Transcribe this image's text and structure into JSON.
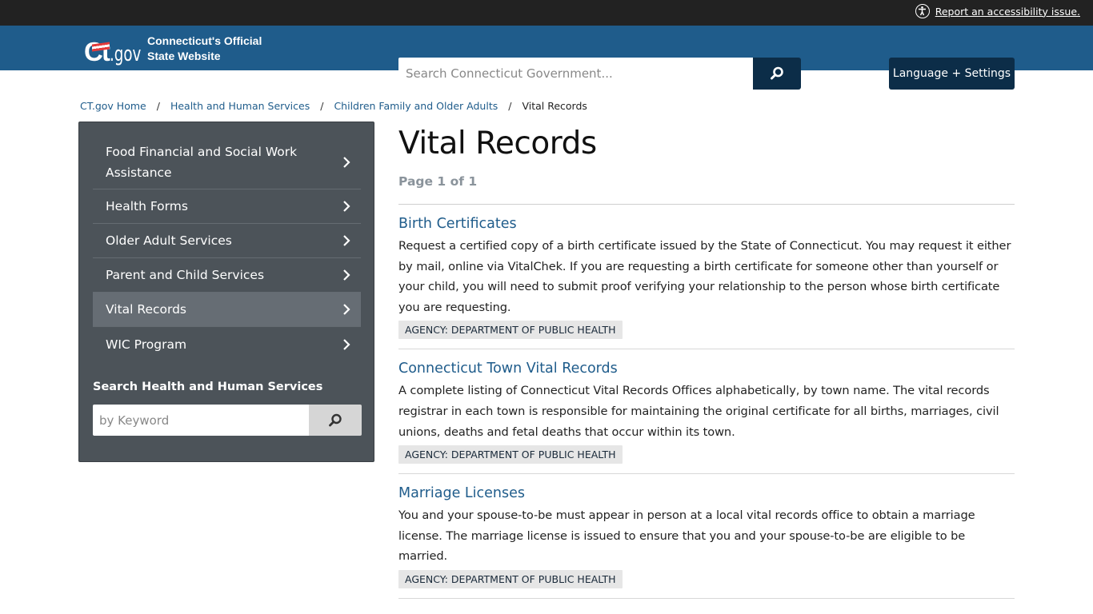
{
  "topbar": {
    "accessibility_link": "Report an accessibility issue."
  },
  "header": {
    "logo_ct": "Ct",
    "logo_gov": ".gov",
    "site_title_line1": "Connecticut's Official",
    "site_title_line2": "State Website",
    "search_placeholder": "Search Connecticut Government...",
    "language_button": "Language + Settings"
  },
  "breadcrumb": [
    {
      "label": "CT.gov Home"
    },
    {
      "label": "Health and Human Services"
    },
    {
      "label": "Children Family and Older Adults"
    },
    {
      "label": "Vital Records"
    }
  ],
  "sidebar": {
    "items": [
      {
        "label": "Food Financial and Social Work Assistance"
      },
      {
        "label": "Health Forms"
      },
      {
        "label": "Older Adult Services"
      },
      {
        "label": "Parent and Child Services"
      },
      {
        "label": "Vital Records",
        "active": true
      },
      {
        "label": "WIC Program"
      }
    ],
    "search_label": "Search Health and Human Services",
    "search_placeholder": "by Keyword"
  },
  "main": {
    "title": "Vital Records",
    "pager": "Page 1 of 1",
    "results": [
      {
        "title": "Birth Certificates",
        "description": "Request a certified copy of a birth certificate issued by the State of Connecticut. You may request it either by mail, online via VitalChek. If you are requesting a birth certificate for someone other than yourself or your child, you will need to submit proof verifying your relationship to the person whose birth certificate you are requesting.",
        "agency": "AGENCY: DEPARTMENT OF PUBLIC HEALTH"
      },
      {
        "title": "Connecticut Town Vital Records",
        "description": "A complete listing of Connecticut Vital Records Offices alphabetically, by town name. The vital records registrar in each town is responsible for maintaining the original certificate for all births, marriages, civil unions, deaths and fetal deaths that occur within its town.",
        "agency": "AGENCY: DEPARTMENT OF PUBLIC HEALTH"
      },
      {
        "title": "Marriage Licenses",
        "description": "You and your spouse-to-be must appear in person at a local vital records office to obtain a marriage license. The marriage license is issued to ensure that you and your spouse-to-be are eligible to be married.",
        "agency": "AGENCY: DEPARTMENT OF PUBLIC HEALTH"
      }
    ]
  },
  "colors": {
    "topbar": "#222222",
    "header": "#1f5c8b",
    "dark_button": "#0c2d48",
    "sidebar": "#4c5359",
    "sidebar_active": "#666d74",
    "link": "#1f5c8b"
  }
}
